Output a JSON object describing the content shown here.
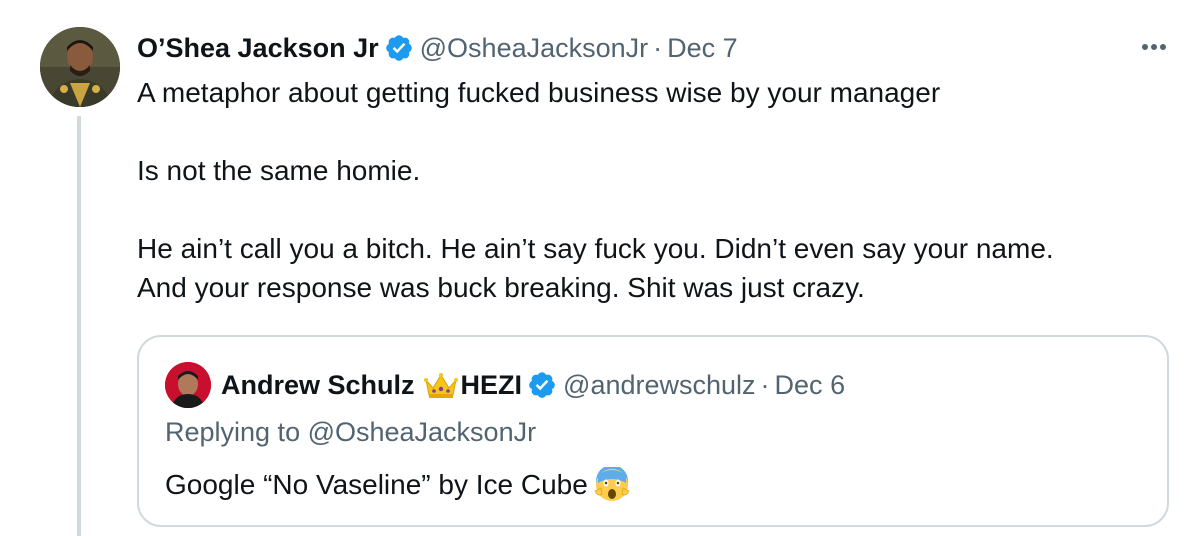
{
  "tweet": {
    "author_name": "O’Shea Jackson Jr",
    "author_handle": "@OsheaJacksonJr",
    "separator": "·",
    "date": "Dec 7",
    "more_icon": "more-horizontal-icon",
    "verified_icon": "verified-badge-icon",
    "text_lines": [
      "A metaphor about getting fucked business wise by your manager",
      "Is not the same homie.",
      "He ain’t call you a bitch. He ain’t say fuck you. Didn’t even say your name.",
      "And your response was buck breaking. Shit was just crazy."
    ]
  },
  "quoted": {
    "author_name_first": "Andrew Schulz",
    "crown_icon": "crown-emoji",
    "author_name_second": "HEZI",
    "author_handle": "@andrewschulz",
    "separator": "·",
    "date": "Dec 6",
    "replying_to": "Replying to @OsheaJacksonJr",
    "text": "Google “No Vaseline” by Ice Cube",
    "emoji_icon": "screaming-face-emoji"
  },
  "colors": {
    "text_primary": "#0f1419",
    "text_secondary": "#536471",
    "verified_blue": "#1d9bf0",
    "border": "#cfd9de"
  }
}
